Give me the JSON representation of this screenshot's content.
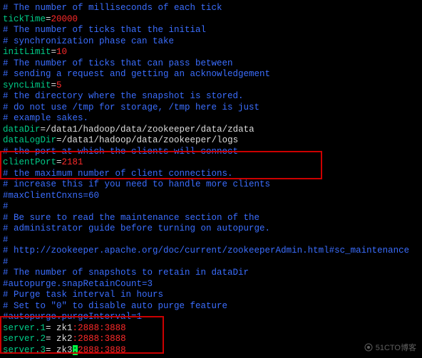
{
  "lines": [
    {
      "type": "comment",
      "text": "# The number of milliseconds of each tick"
    },
    {
      "type": "kv",
      "key": "tickTime",
      "val": "20000",
      "valColor": "num"
    },
    {
      "type": "comment",
      "text": "# The number of ticks that the initial"
    },
    {
      "type": "comment",
      "text": "# synchronization phase can take"
    },
    {
      "type": "kv",
      "key": "initLimit",
      "val": "10",
      "valColor": "num"
    },
    {
      "type": "comment",
      "text": "# The number of ticks that can pass between"
    },
    {
      "type": "comment",
      "text": "# sending a request and getting an acknowledgement"
    },
    {
      "type": "kv",
      "key": "syncLimit",
      "val": "5",
      "valColor": "num"
    },
    {
      "type": "comment",
      "text": "# the directory where the snapshot is stored."
    },
    {
      "type": "comment",
      "text": "# do not use /tmp for storage, /tmp here is just"
    },
    {
      "type": "comment",
      "text": "# example sakes."
    },
    {
      "type": "kv",
      "key": "dataDir",
      "val": "/data1/hadoop/data/zookeeper/data/zdata",
      "valColor": "val"
    },
    {
      "type": "kv",
      "key": "dataLogDir",
      "val": "/data1/hadoop/data/zookeeper/logs",
      "valColor": "val"
    },
    {
      "type": "comment",
      "text": "# the port at which the clients will connect"
    },
    {
      "type": "kv",
      "key": "clientPort",
      "val": "2181",
      "valColor": "num"
    },
    {
      "type": "comment",
      "text": "# the maximum number of client connections."
    },
    {
      "type": "comment",
      "text": "# increase this if you need to handle more clients"
    },
    {
      "type": "comment",
      "text": "#maxClientCnxns=60"
    },
    {
      "type": "comment",
      "text": "#"
    },
    {
      "type": "comment",
      "text": "# Be sure to read the maintenance section of the"
    },
    {
      "type": "comment",
      "text": "# administrator guide before turning on autopurge."
    },
    {
      "type": "comment",
      "text": "#"
    },
    {
      "type": "comment",
      "text": "# http://zookeeper.apache.org/doc/current/zookeeperAdmin.html#sc_maintenance"
    },
    {
      "type": "comment",
      "text": "#"
    },
    {
      "type": "comment",
      "text": "# The number of snapshots to retain in dataDir"
    },
    {
      "type": "comment",
      "text": "#autopurge.snapRetainCount=3"
    },
    {
      "type": "comment",
      "text": "# Purge task interval in hours"
    },
    {
      "type": "comment",
      "text": "# Set to \"0\" to disable auto purge feature"
    },
    {
      "type": "comment",
      "text": "#autopurge.purgeInterval=1"
    },
    {
      "type": "server",
      "key": "server.1",
      "host": " zk1",
      "sep": ":",
      "p1": "2888",
      "p2": "3888"
    },
    {
      "type": "server",
      "key": "server.2",
      "host": " zk2",
      "sep": ":",
      "p1": "2888",
      "p2": "3888"
    },
    {
      "type": "server",
      "key": "server.3",
      "host": " zk3",
      "sep": ":",
      "p1": "2888",
      "p2": "3888",
      "cursor": true
    }
  ],
  "watermark": "51CTO博客"
}
